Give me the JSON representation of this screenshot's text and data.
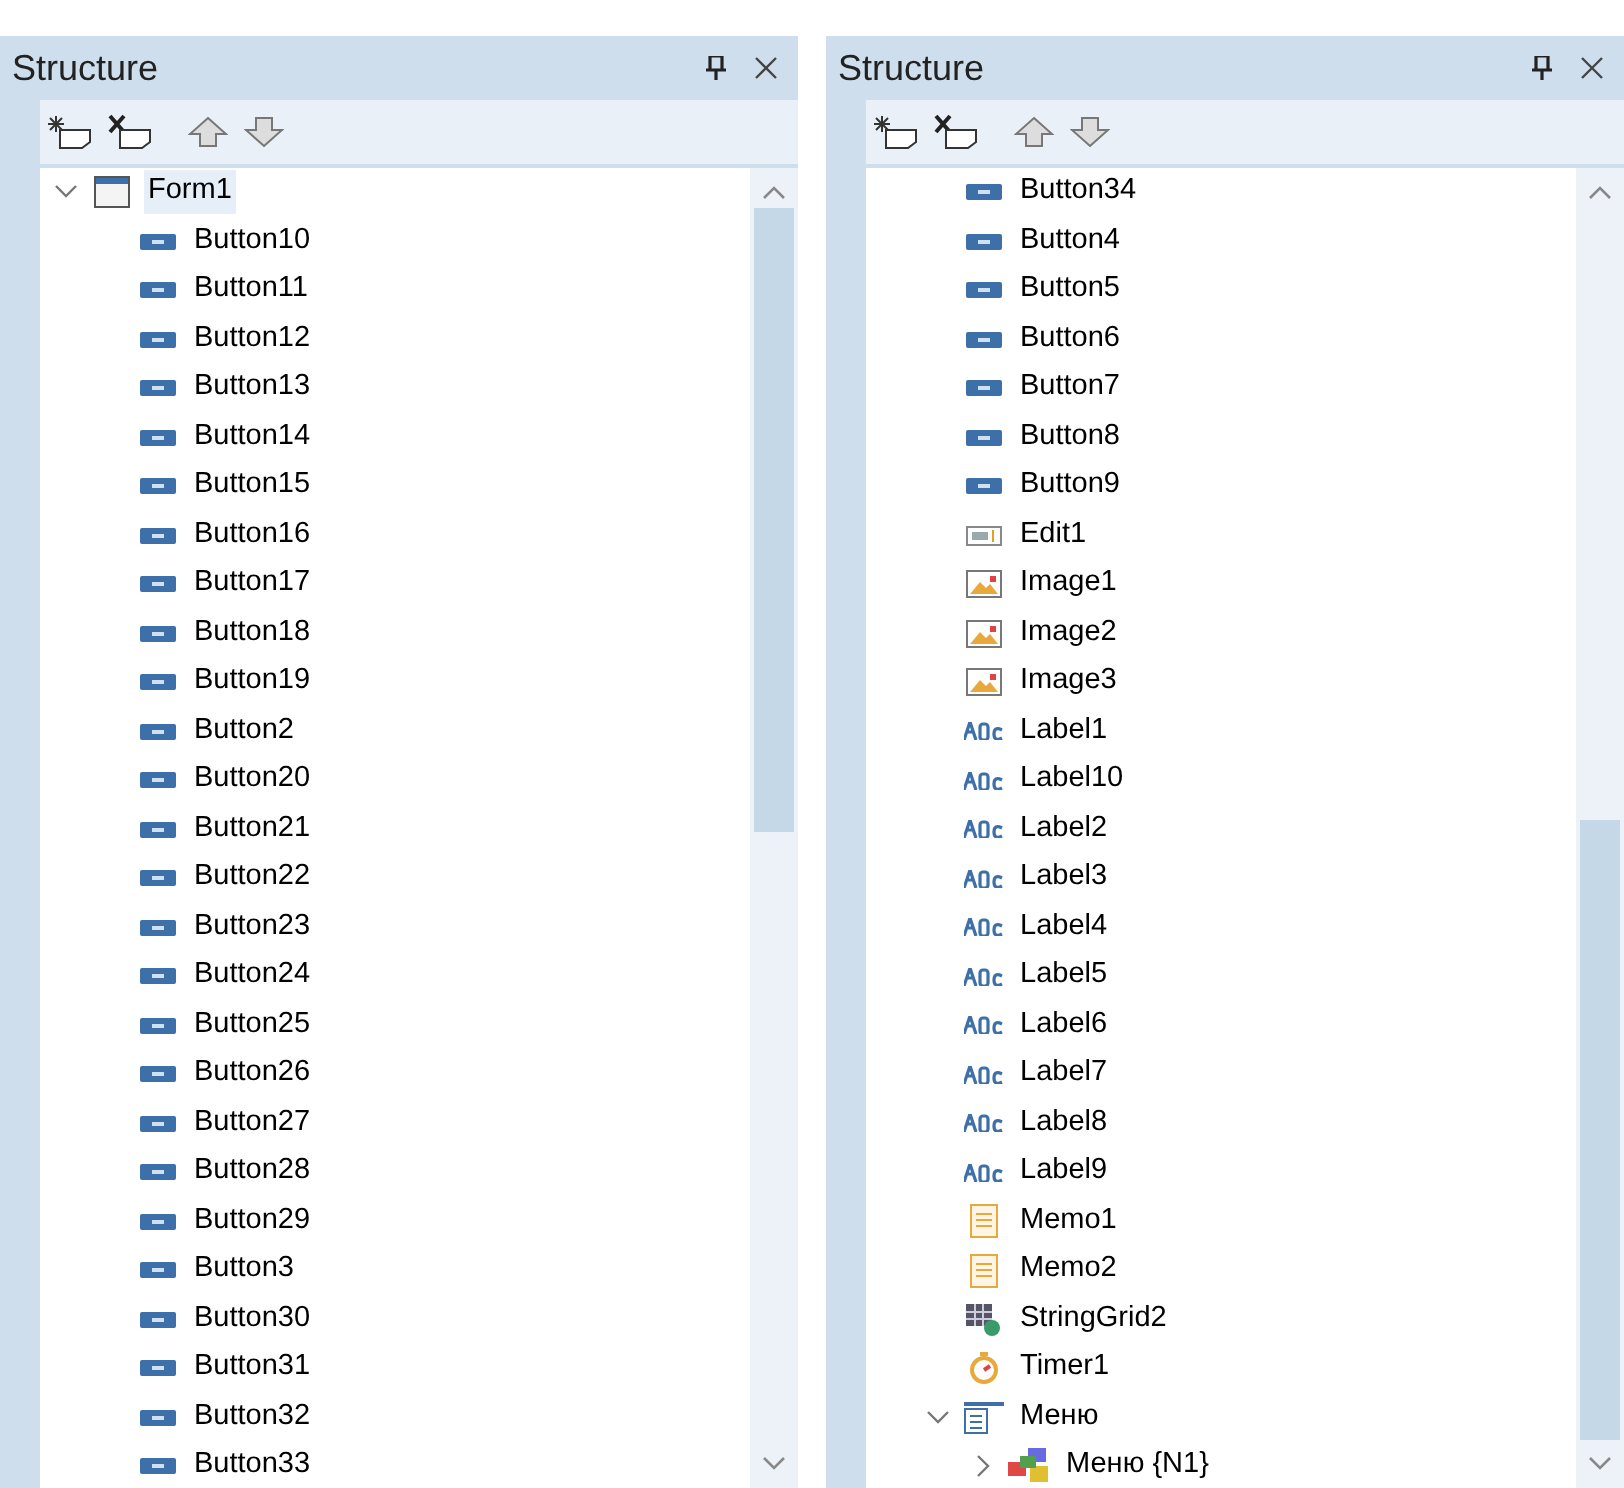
{
  "panels": [
    {
      "title": "Structure",
      "tree": [
        {
          "label": "Form1",
          "kind": "form",
          "selected": true,
          "expanded": true,
          "children": [
            {
              "label": "Button10",
              "kind": "button"
            },
            {
              "label": "Button11",
              "kind": "button"
            },
            {
              "label": "Button12",
              "kind": "button"
            },
            {
              "label": "Button13",
              "kind": "button"
            },
            {
              "label": "Button14",
              "kind": "button"
            },
            {
              "label": "Button15",
              "kind": "button"
            },
            {
              "label": "Button16",
              "kind": "button"
            },
            {
              "label": "Button17",
              "kind": "button"
            },
            {
              "label": "Button18",
              "kind": "button"
            },
            {
              "label": "Button19",
              "kind": "button"
            },
            {
              "label": "Button2",
              "kind": "button"
            },
            {
              "label": "Button20",
              "kind": "button"
            },
            {
              "label": "Button21",
              "kind": "button"
            },
            {
              "label": "Button22",
              "kind": "button"
            },
            {
              "label": "Button23",
              "kind": "button"
            },
            {
              "label": "Button24",
              "kind": "button"
            },
            {
              "label": "Button25",
              "kind": "button"
            },
            {
              "label": "Button26",
              "kind": "button"
            },
            {
              "label": "Button27",
              "kind": "button"
            },
            {
              "label": "Button28",
              "kind": "button"
            },
            {
              "label": "Button29",
              "kind": "button"
            },
            {
              "label": "Button3",
              "kind": "button"
            },
            {
              "label": "Button30",
              "kind": "button"
            },
            {
              "label": "Button31",
              "kind": "button"
            },
            {
              "label": "Button32",
              "kind": "button"
            },
            {
              "label": "Button33",
              "kind": "button"
            }
          ]
        }
      ]
    },
    {
      "title": "Structure",
      "tree": [
        {
          "label": "Button34",
          "kind": "button"
        },
        {
          "label": "Button4",
          "kind": "button"
        },
        {
          "label": "Button5",
          "kind": "button"
        },
        {
          "label": "Button6",
          "kind": "button"
        },
        {
          "label": "Button7",
          "kind": "button"
        },
        {
          "label": "Button8",
          "kind": "button"
        },
        {
          "label": "Button9",
          "kind": "button"
        },
        {
          "label": "Edit1",
          "kind": "edit"
        },
        {
          "label": "Image1",
          "kind": "image"
        },
        {
          "label": "Image2",
          "kind": "image"
        },
        {
          "label": "Image3",
          "kind": "image"
        },
        {
          "label": "Label1",
          "kind": "label"
        },
        {
          "label": "Label10",
          "kind": "label"
        },
        {
          "label": "Label2",
          "kind": "label"
        },
        {
          "label": "Label3",
          "kind": "label"
        },
        {
          "label": "Label4",
          "kind": "label"
        },
        {
          "label": "Label5",
          "kind": "label"
        },
        {
          "label": "Label6",
          "kind": "label"
        },
        {
          "label": "Label7",
          "kind": "label"
        },
        {
          "label": "Label8",
          "kind": "label"
        },
        {
          "label": "Label9",
          "kind": "label"
        },
        {
          "label": "Memo1",
          "kind": "memo"
        },
        {
          "label": "Memo2",
          "kind": "memo"
        },
        {
          "label": "StringGrid2",
          "kind": "grid"
        },
        {
          "label": "Timer1",
          "kind": "timer"
        },
        {
          "label": "Меню",
          "kind": "menu",
          "expanded": true,
          "children": [
            {
              "label": "Меню {N1}",
              "kind": "menuitem",
              "expanded": false
            }
          ]
        }
      ]
    }
  ]
}
